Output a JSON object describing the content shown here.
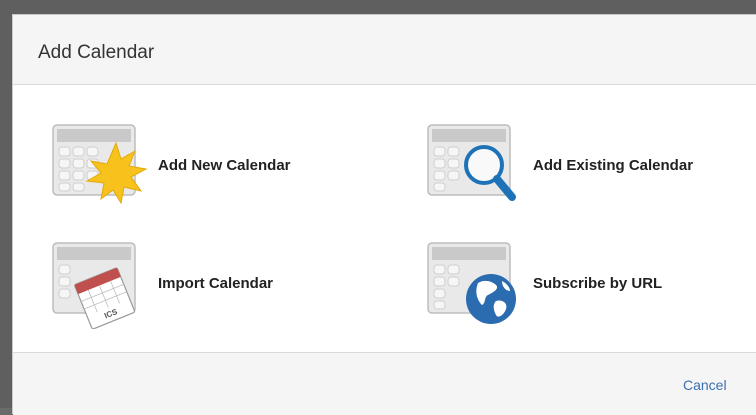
{
  "dialog": {
    "title": "Add Calendar",
    "cancel_label": "Cancel"
  },
  "options": [
    {
      "label": "Add New Calendar",
      "icon": "calendar-starburst-icon"
    },
    {
      "label": "Add Existing Calendar",
      "icon": "calendar-magnifier-icon"
    },
    {
      "label": "Import Calendar",
      "icon": "calendar-ics-file-icon"
    },
    {
      "label": "Subscribe by URL",
      "icon": "calendar-globe-icon"
    }
  ],
  "colors": {
    "link": "#3a6fb0",
    "starburst": "#f7c21b",
    "magnifier": "#1e73b8",
    "ics_header": "#c0504d",
    "globe": "#2b6bb0"
  }
}
